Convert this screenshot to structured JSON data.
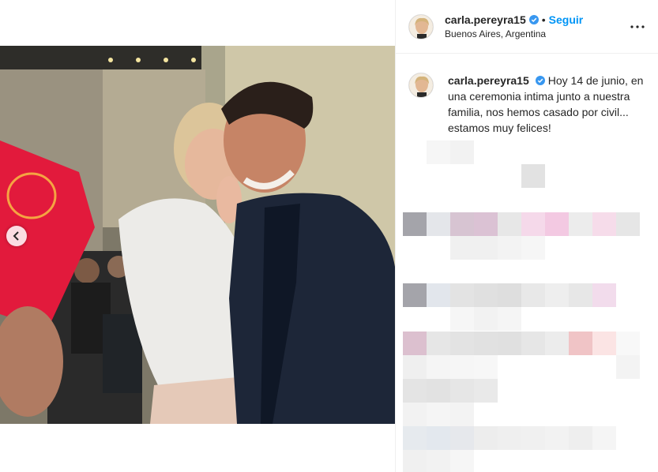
{
  "post": {
    "username": "carla.pereyra15",
    "follow_label": "Seguir",
    "separator": "•",
    "location": "Buenos Aires, Argentina",
    "caption": "Hoy 14 de junio, en una ceremonia intima junto a nuestra familia, nos hemos casado por civil... estamos muy felices!"
  },
  "icons": {
    "verified": "verified-badge-icon",
    "more": "more-options-icon",
    "prev": "chevron-left-icon"
  },
  "colors": {
    "accent": "#0095f6",
    "verified": "#3897f0"
  }
}
